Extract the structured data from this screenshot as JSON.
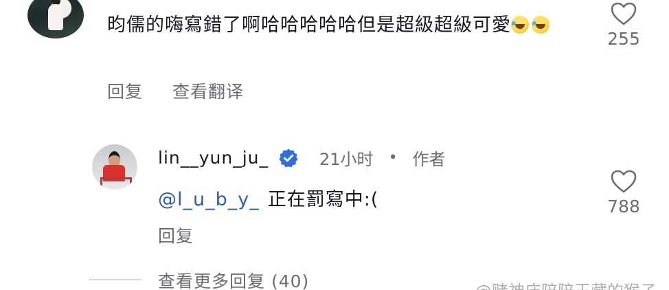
{
  "top_comment": {
    "text": "昀儒的嗨寫錯了啊哈哈哈哈哈但是超級超級可愛",
    "emojis": [
      "rolling-on-floor-laughing-emoji",
      "rolling-on-floor-laughing-emoji"
    ],
    "reply_label": "回复",
    "translate_label": "查看翻译",
    "like_count": "255"
  },
  "reply": {
    "username": "lin__yun_ju_",
    "verified": true,
    "time": "21小时",
    "separator": "•",
    "author_tag": "作者",
    "mention": "@l_u_b_y_",
    "text": "正在罰寫中:(",
    "reply_label": "回复",
    "like_count": "788"
  },
  "view_more": "查看更多回复 (40)",
  "watermark": "@赌神庙陪陪玉藏的猴子",
  "colors": {
    "text": "#161823",
    "secondary": "#6b6d75",
    "mention": "#2b5db8",
    "verified": "#2f6fe0"
  }
}
